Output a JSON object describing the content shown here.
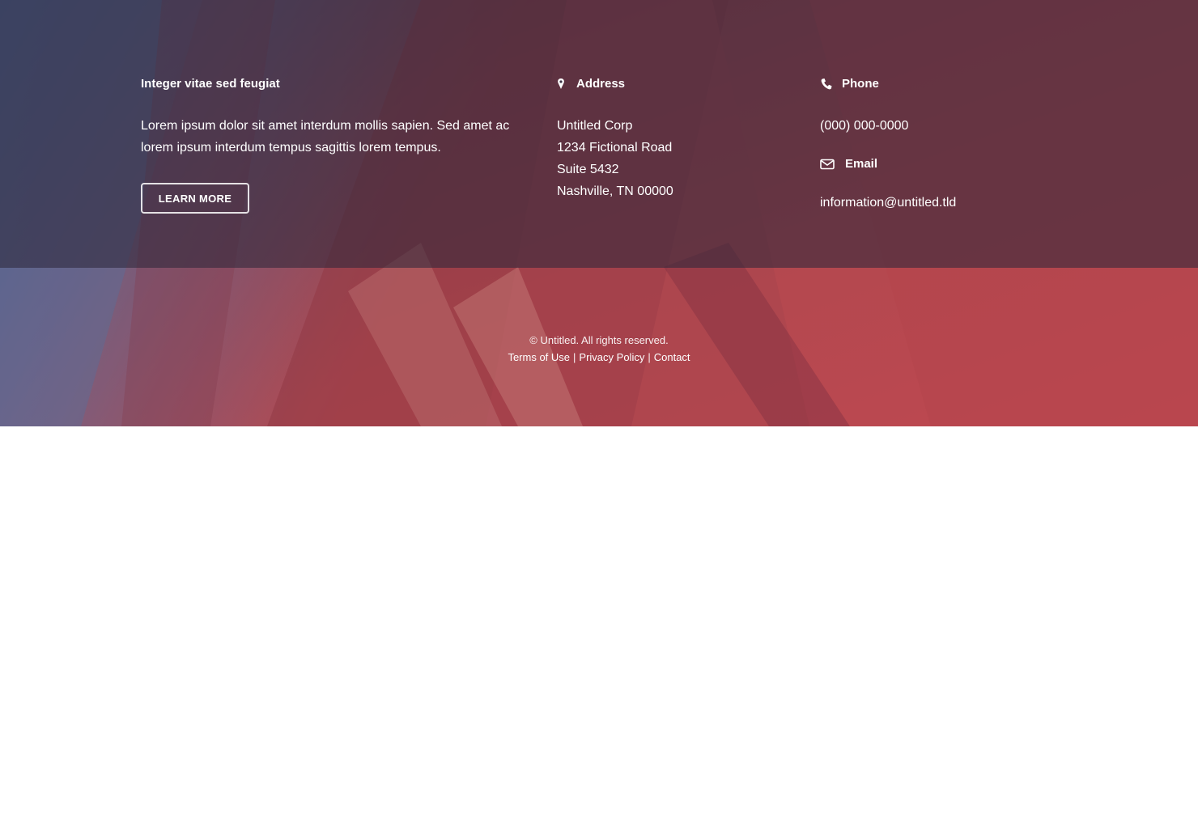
{
  "about": {
    "heading": "Integer vitae sed feugiat",
    "text": "Lorem ipsum dolor sit amet interdum mollis sapien. Sed amet ac lorem ipsum interdum tempus sagittis lorem tempus.",
    "button_label": "Learn More"
  },
  "address": {
    "heading": "Address",
    "icon": "map-marker-icon",
    "lines": [
      "Untitled Corp",
      "1234 Fictional Road",
      "Suite 5432",
      "Nashville, TN 00000"
    ]
  },
  "phone": {
    "heading": "Phone",
    "icon": "phone-icon",
    "value": "(000) 000-0000"
  },
  "email": {
    "heading": "Email",
    "icon": "envelope-icon",
    "value": "information@untitled.tld"
  },
  "copyright": {
    "text": "© Untitled. All rights reserved.",
    "links": [
      "Terms of Use",
      "Privacy Policy",
      "Contact"
    ],
    "separator": "|"
  },
  "colors": {
    "text": "#ffffff",
    "overlay": "#2d283c",
    "accent_red": "#c44a4f"
  }
}
